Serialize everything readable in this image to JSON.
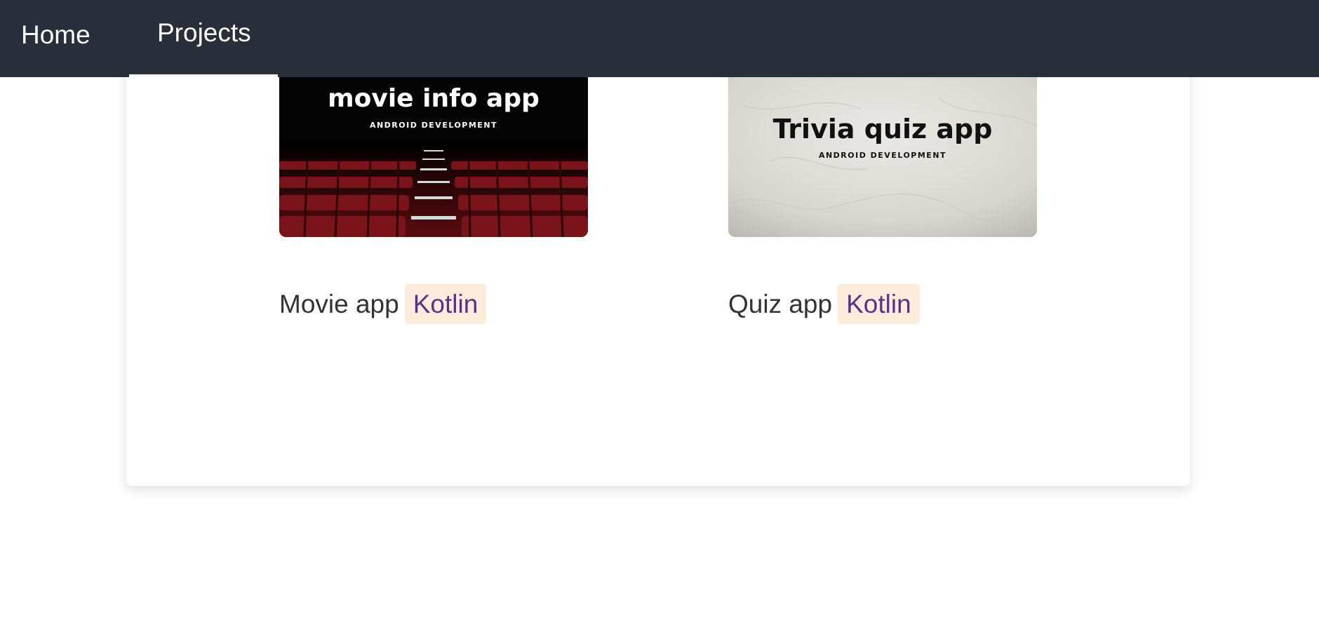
{
  "nav": {
    "home_label": "Home",
    "projects_label": "Projects"
  },
  "projects": [
    {
      "thumbnail_title": "movie info app",
      "thumbnail_subtitle": "ANDROID DEVELOPMENT",
      "name": "Movie app",
      "tag": "Kotlin"
    },
    {
      "thumbnail_title": "Trivia quiz app",
      "thumbnail_subtitle": "ANDROID DEVELOPMENT",
      "name": "Quiz app",
      "tag": "Kotlin"
    }
  ],
  "colors": {
    "navbar_bg": "#282e3a",
    "tag_bg": "#fdecdb",
    "tag_text": "#583288",
    "body_text": "#333333"
  }
}
